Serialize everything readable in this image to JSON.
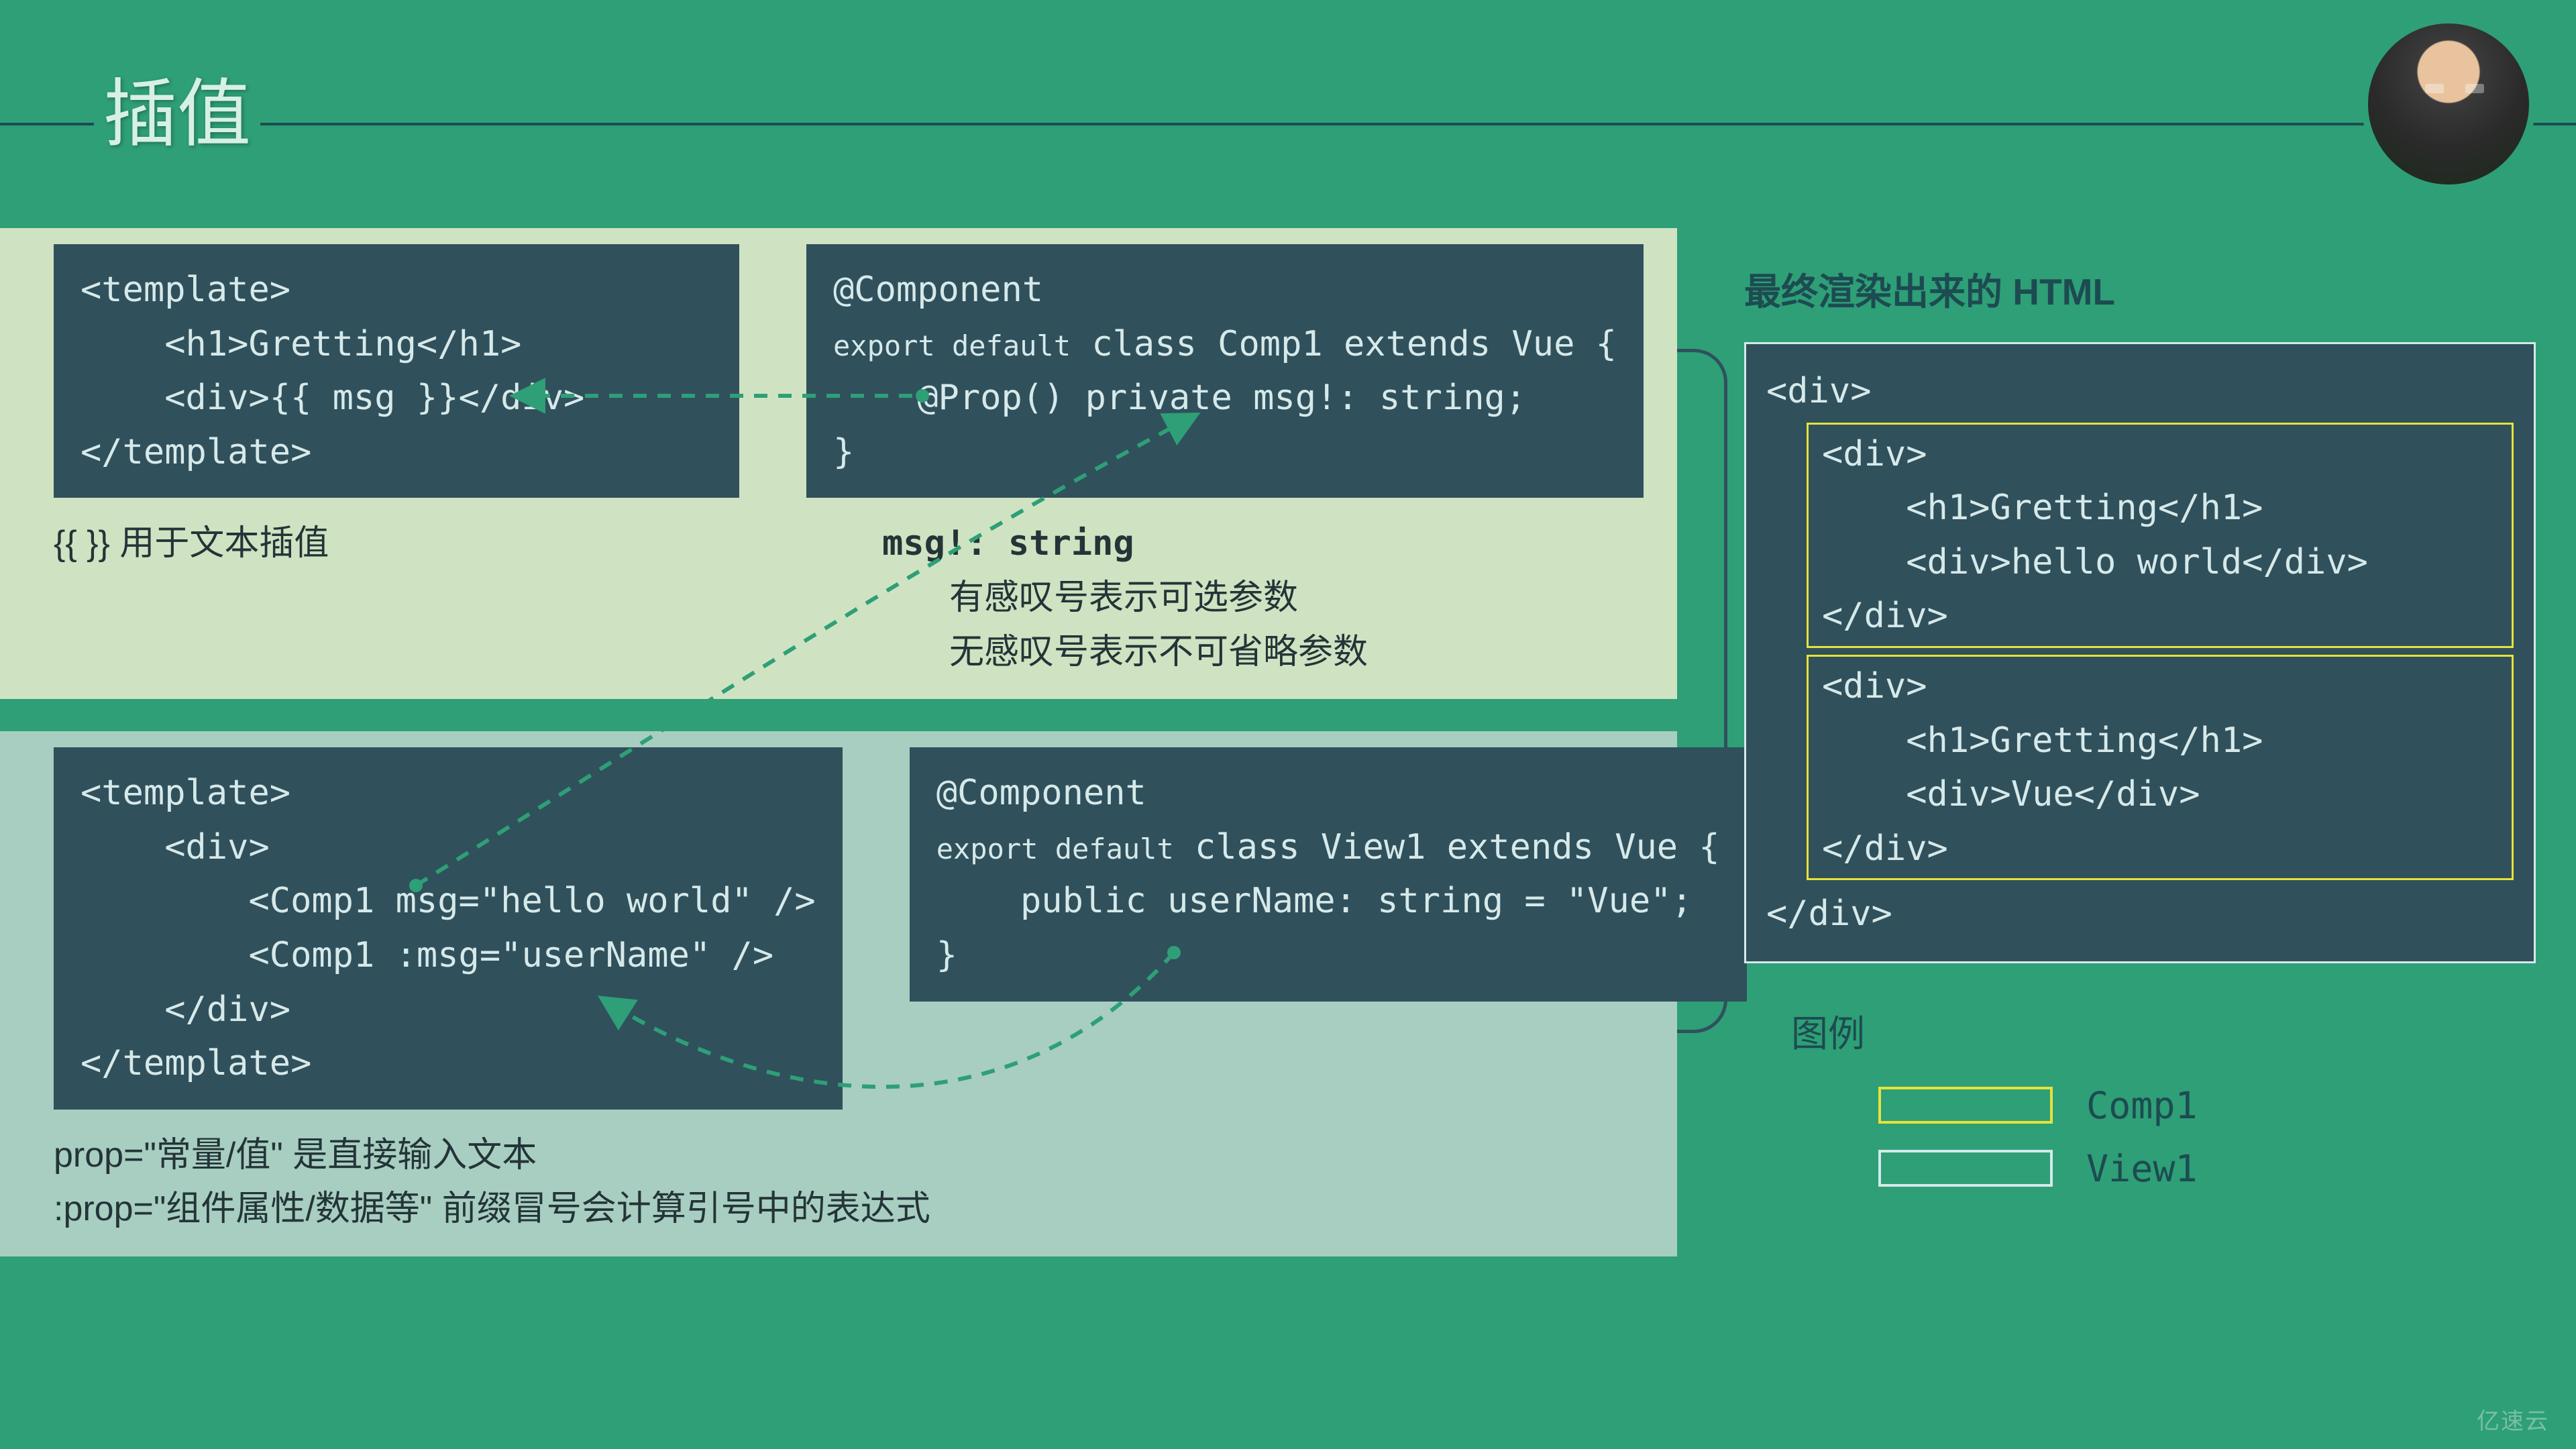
{
  "title": "插值",
  "panel_top": {
    "code_left": "<template>\n    <h1>Gretting</h1>\n    <div>{{ msg }}</div>\n</template>",
    "code_right_l1": "@Component",
    "code_right_l2": "export default",
    "code_right_l2b": " class Comp1 extends Vue {",
    "code_right_l3": "    @Prop() private msg!: string;",
    "code_right_l4": "}",
    "caption_left": "{{  }} 用于文本插值",
    "caption_right_head": "msg!: string",
    "caption_right_1": "有感叹号表示可选参数",
    "caption_right_2": "无感叹号表示不可省略参数"
  },
  "panel_bot": {
    "code_left": "<template>\n    <div>\n        <Comp1 msg=\"hello world\" />\n        <Comp1 :msg=\"userName\" />\n    </div>\n</template>",
    "code_right_l1": "@Component",
    "code_right_l2": "export default",
    "code_right_l2b": " class View1 extends Vue {",
    "code_right_l3": "    public userName: string = \"Vue\";",
    "code_right_l4": "}",
    "caption_1": "prop=\"常量/值\" 是直接输入文本",
    "caption_2": ":prop=\"组件属性/数据等\" 前缀冒号会计算引号中的表达式"
  },
  "right": {
    "heading": "最终渲染出来的 HTML",
    "open": "<div>",
    "blk1_l1": "<div>",
    "blk1_l2": "    <h1>Gretting</h1>",
    "blk1_l3": "    <div>hello world</div>",
    "blk1_l4": "</div>",
    "blk2_l1": "<div>",
    "blk2_l2": "    <h1>Gretting</h1>",
    "blk2_l3": "    <div>Vue</div>",
    "blk2_l4": "</div>",
    "close": "</div>",
    "legend_title": "图例",
    "legend": [
      {
        "label": "Comp1",
        "color": "#e5e23a"
      },
      {
        "label": "View1",
        "color": "#d6e9e9"
      }
    ]
  },
  "watermark": "亿速云"
}
